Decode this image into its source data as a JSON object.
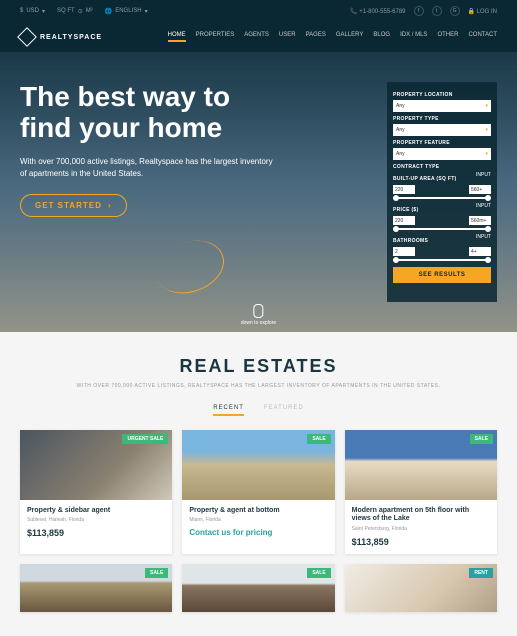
{
  "topbar": {
    "currency": "USD",
    "area": "SQ FT",
    "m2": "M²",
    "lang": "ENGLISH",
    "phone": "+1-800-555-6789",
    "login": "LOG IN"
  },
  "brand": "REALTYSPACE",
  "nav": [
    "HOME",
    "PROPERTIES",
    "AGENTS",
    "USER",
    "PAGES",
    "GALLERY",
    "BLOG",
    "IDX / MLS",
    "OTHER",
    "CONTACT"
  ],
  "hero": {
    "title": "The best way to find your home",
    "sub": "With over 700,000 active listings, Realtyspace has the largest inventory of apartments in the United States.",
    "cta": "GET STARTED",
    "scroll": "down to explore"
  },
  "search": {
    "loc_label": "PROPERTY LOCATION",
    "loc": "Any",
    "type_label": "PROPERTY TYPE",
    "type": "Any",
    "feat_label": "PROPERTY FEATURE",
    "feat": "Any",
    "contract_label": "CONTRACT TYPE",
    "area_label": "BUILT-UP AREA (SQ FT)",
    "area_min": "220",
    "area_max": "560+",
    "area_end": "INPUT",
    "price_label": "PRICE ($)",
    "price_min": "220",
    "price_max": "560m+",
    "price_end": "INPUT",
    "bath_label": "BATHROOMS",
    "bath_min": "2",
    "bath_max": "4+",
    "bath_end": "INPUT",
    "submit": "SEE RESULTS"
  },
  "estates": {
    "title": "REAL ESTATES",
    "sub": "WITH OVER 700,000 ACTIVE LISTINGS, REALTYSPACE HAS THE LARGEST INVENTORY OF APARTMENTS IN THE UNITED STATES.",
    "tabs": [
      "RECENT",
      "FEATURED"
    ]
  },
  "cards": [
    {
      "badge": "URGENT SALE",
      "title": "Property & sidebar agent",
      "loc": "Sublevel, Hialeah, Florida",
      "price": "$113,859"
    },
    {
      "badge": "SALE",
      "title": "Property & agent at bottom",
      "loc": "Miami, Florida",
      "price": "Contact us for pricing"
    },
    {
      "badge": "SALE",
      "title": "Modern apartment on 5th floor with views of the Lake",
      "loc": "Saint Petersburg, Florida",
      "price": "$113,859"
    },
    {
      "badge": "SALE"
    },
    {
      "badge": "SALE"
    },
    {
      "badge": "RENT"
    }
  ]
}
